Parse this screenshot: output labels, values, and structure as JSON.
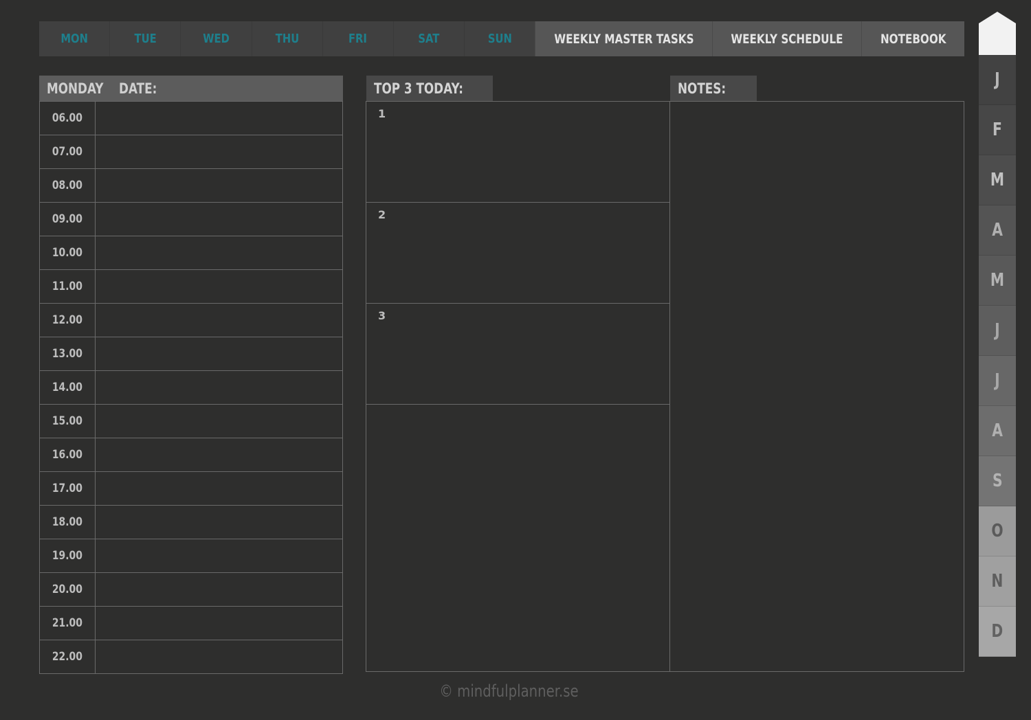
{
  "nav": {
    "days": [
      "MON",
      "TUE",
      "WED",
      "THU",
      "FRI",
      "SAT",
      "SUN"
    ],
    "weekly_master_tasks": "WEEKLY MASTER TASKS",
    "weekly_schedule": "WEEKLY SCHEDULE",
    "notebook": "NOTEBOOK"
  },
  "schedule": {
    "day": "MONDAY",
    "date_label": "DATE:",
    "times": [
      "06.00",
      "07.00",
      "08.00",
      "09.00",
      "10.00",
      "11.00",
      "12.00",
      "13.00",
      "14.00",
      "15.00",
      "16.00",
      "17.00",
      "18.00",
      "19.00",
      "20.00",
      "21.00",
      "22.00"
    ]
  },
  "top3": {
    "title": "TOP 3 TODAY:",
    "items": [
      "1",
      "2",
      "3"
    ]
  },
  "notes": {
    "title": "NOTES:"
  },
  "months": [
    {
      "letter": "J",
      "bg": "#424242",
      "fg": "#b8b8b8"
    },
    {
      "letter": "F",
      "bg": "#474747",
      "fg": "#bcbcbc"
    },
    {
      "letter": "M",
      "bg": "#4d4d4d",
      "fg": "#c2c2c2"
    },
    {
      "letter": "A",
      "bg": "#545454",
      "fg": "#b0b0b0"
    },
    {
      "letter": "M",
      "bg": "#595959",
      "fg": "#b4b4b4"
    },
    {
      "letter": "J",
      "bg": "#5e5e5e",
      "fg": "#a8a8a8"
    },
    {
      "letter": "J",
      "bg": "#676767",
      "fg": "#a8a8a8"
    },
    {
      "letter": "A",
      "bg": "#6d6d6d",
      "fg": "#b0b0b0"
    },
    {
      "letter": "S",
      "bg": "#747474",
      "fg": "#b3b3b3"
    },
    {
      "letter": "O",
      "bg": "#9b9b9b",
      "fg": "#5a5a5a"
    },
    {
      "letter": "N",
      "bg": "#a0a0a0",
      "fg": "#5e5e5e"
    },
    {
      "letter": "D",
      "bg": "#a7a7a7",
      "fg": "#626262"
    }
  ],
  "colors": {
    "background": "#2e2e2d",
    "accent_teal": "#1e7f8c",
    "home_tab": "#f2f2f2"
  },
  "footer": "© mindfulplanner.se"
}
